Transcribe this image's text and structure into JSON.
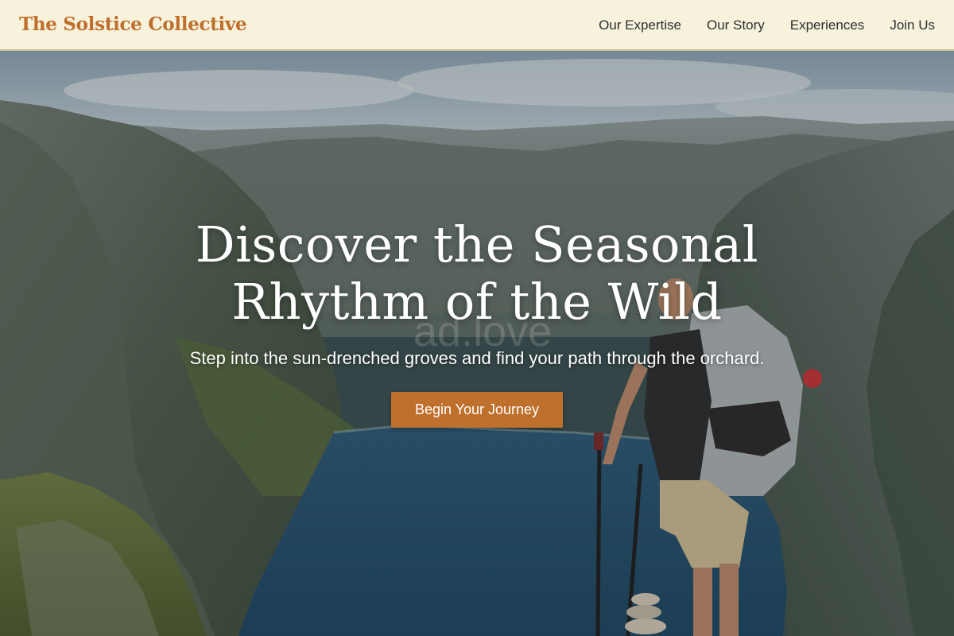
{
  "header": {
    "brand": "The Solstice Collective",
    "nav": [
      {
        "label": "Our Expertise"
      },
      {
        "label": "Our Story"
      },
      {
        "label": "Experiences"
      },
      {
        "label": "Join Us"
      }
    ]
  },
  "hero": {
    "title_line1": "Discover the Seasonal",
    "title_line2": "Rhythm of the Wild",
    "subtitle": "Step into the sun-drenched groves and find your path through the orchard.",
    "cta_label": "Begin Your Journey",
    "watermark": "ad.love"
  },
  "colors": {
    "accent": "#c0702d",
    "brand": "#bf6f2b",
    "nav_bg": "#f6f2dc",
    "nav_text": "#2e2e2e"
  }
}
